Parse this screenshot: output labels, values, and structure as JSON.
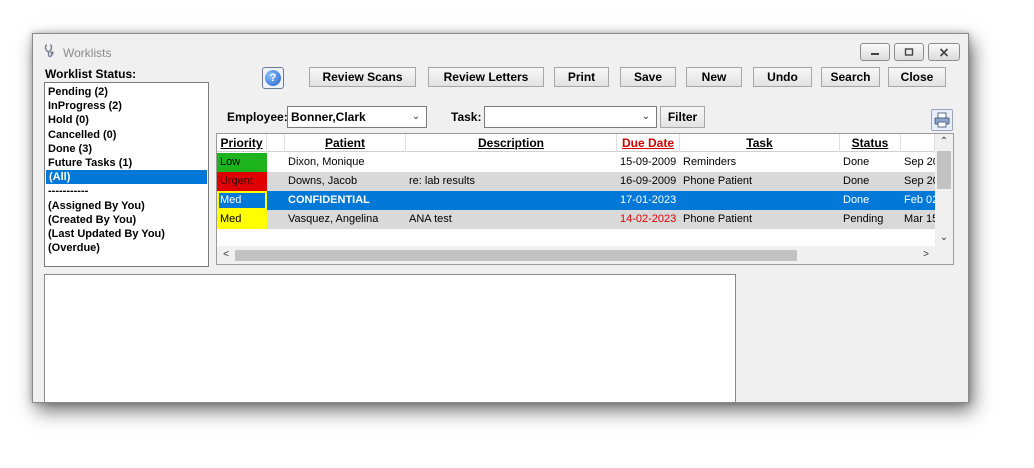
{
  "window": {
    "title": "Worklists",
    "icons": {
      "app": "stethoscope-icon",
      "minimize": "minimize-icon",
      "maximize": "maximize-icon",
      "close": "close-icon"
    }
  },
  "status_panel": {
    "label": "Worklist Status:",
    "items": [
      {
        "label": "Pending (2)",
        "selected": false
      },
      {
        "label": "InProgress (2)",
        "selected": false
      },
      {
        "label": "Hold (0)",
        "selected": false
      },
      {
        "label": "Cancelled (0)",
        "selected": false
      },
      {
        "label": "Done (3)",
        "selected": false
      },
      {
        "label": "Future Tasks (1)",
        "selected": false
      },
      {
        "label": "(All)",
        "selected": true
      },
      {
        "label": "-----------",
        "selected": false
      },
      {
        "label": "(Assigned By You)",
        "selected": false
      },
      {
        "label": "(Created By You)",
        "selected": false
      },
      {
        "label": "(Last Updated By You)",
        "selected": false
      },
      {
        "label": "(Overdue)",
        "selected": false
      }
    ]
  },
  "toolbar": {
    "help_icon": "help-icon",
    "help_glyph": "?",
    "review_scans": "Review Scans",
    "review_letters": "Review Letters",
    "print": "Print",
    "save": "Save",
    "new": "New",
    "undo": "Undo",
    "search": "Search",
    "close": "Close"
  },
  "filters": {
    "employee_label": "Employee:",
    "employee_value": "Bonner,Clark",
    "task_label": "Task:",
    "task_value": "",
    "filter_button": "Filter",
    "printer_icon": "printer-icon"
  },
  "grid": {
    "columns": [
      "Priority",
      "Patient",
      "Description",
      "Due Date",
      "Task",
      "Status"
    ],
    "rows": [
      {
        "priority": "Low",
        "priority_color": "#1db31d",
        "patient": "Dixon, Monique",
        "description": "",
        "due_date": "15-09-2009",
        "task": "Reminders",
        "status": "Done",
        "extra": "Sep 20",
        "style": "normal"
      },
      {
        "priority": "Urgent",
        "priority_color": "#e00000",
        "patient": "Downs, Jacob",
        "description": "re: lab results",
        "due_date": "16-09-2009",
        "task": "Phone Patient",
        "status": "Done",
        "extra": "Sep 20",
        "style": "alt"
      },
      {
        "priority": "Med",
        "priority_color": "#ffff00",
        "patient": "CONFIDENTIAL",
        "description": "",
        "due_date": "17-01-2023",
        "task": "",
        "status": "Done",
        "extra": "Feb 02",
        "style": "selected"
      },
      {
        "priority": "Med",
        "priority_color": "#ffff00",
        "patient": "Vasquez, Angelina",
        "description": "ANA test",
        "due_date": "14-02-2023",
        "task": "Phone Patient",
        "status": "Pending",
        "extra": "Mar 15",
        "style": "alt",
        "overdue": true
      }
    ],
    "scroll_glyphs": {
      "up": "⌃",
      "down": "⌄",
      "left": "<",
      "right": ">"
    }
  },
  "colors": {
    "selection": "#0078d7",
    "alt_row": "#d9d9d9",
    "overdue_text": "#e00000",
    "due_header": "#d40000"
  }
}
